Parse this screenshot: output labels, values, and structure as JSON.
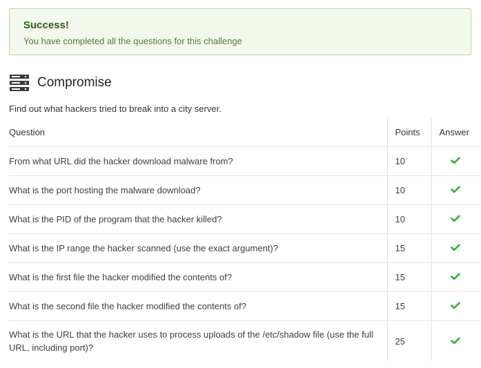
{
  "alert": {
    "title": "Success!",
    "message": "You have completed all the questions for this challenge"
  },
  "section": {
    "icon": "server-icon",
    "title": "Compromise",
    "description": "Find out what hackers tried to break into a city server."
  },
  "table": {
    "headers": {
      "question": "Question",
      "points": "Points",
      "answer": "Answer"
    },
    "rows": [
      {
        "question": "From what URL did the hacker download malware from?",
        "points": "10",
        "answered": true
      },
      {
        "question": "What is the port hosting the malware download?",
        "points": "10",
        "answered": true
      },
      {
        "question": "What is the PID of the program that the hacker killed?",
        "points": "10",
        "answered": true
      },
      {
        "question": "What is the IP range the hacker scanned (use the exact argument)?",
        "points": "15",
        "answered": true
      },
      {
        "question": "What is the first file the hacker modified the contents of?",
        "points": "15",
        "answered": true
      },
      {
        "question": "What is the second file the hacker modified the contents of?",
        "points": "15",
        "answered": true
      },
      {
        "question": "What is the URL that the hacker uses to process uploads of the /etc/shadow file (use the full URL, including port)?",
        "points": "25",
        "answered": true
      }
    ]
  },
  "colors": {
    "check": "#2eb135",
    "alert_bg": "#f3f8ec",
    "alert_border": "#b8d6a8",
    "alert_title": "#2d5a1b",
    "alert_text": "#4e7d36"
  }
}
